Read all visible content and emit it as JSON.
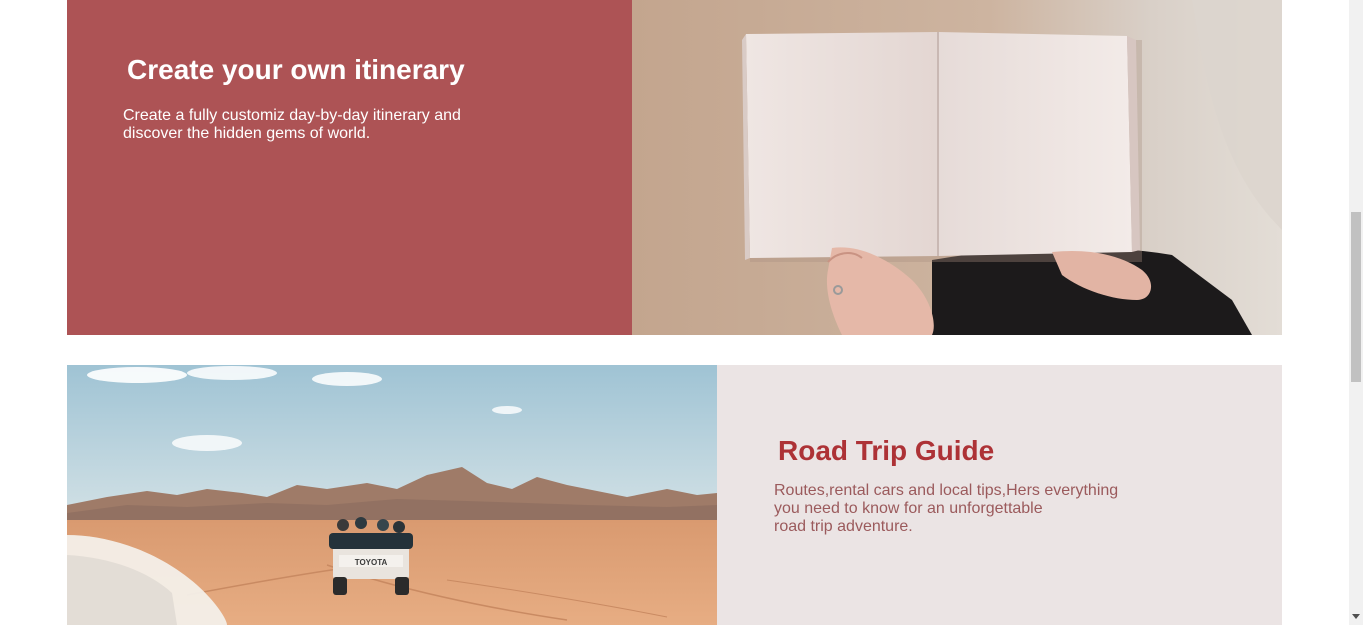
{
  "itinerary": {
    "title": "Create your own itinerary",
    "description": "Create a fully customiz day-by-day itinerary and discover the hidden gems of world.",
    "accent_color": "#ad5355"
  },
  "road_trip": {
    "title": "Road Trip Guide",
    "description_lines": [
      "Routes,rental cars and local tips,Hers everything",
      "you need to know for an unforgettable",
      "road trip adventure."
    ],
    "title_color": "#ad3236",
    "panel_color": "#ebe4e4"
  },
  "images": {
    "book": "open-book-photo",
    "desert": "desert-road-trip-photo",
    "car_plate": "TOYOTA"
  }
}
